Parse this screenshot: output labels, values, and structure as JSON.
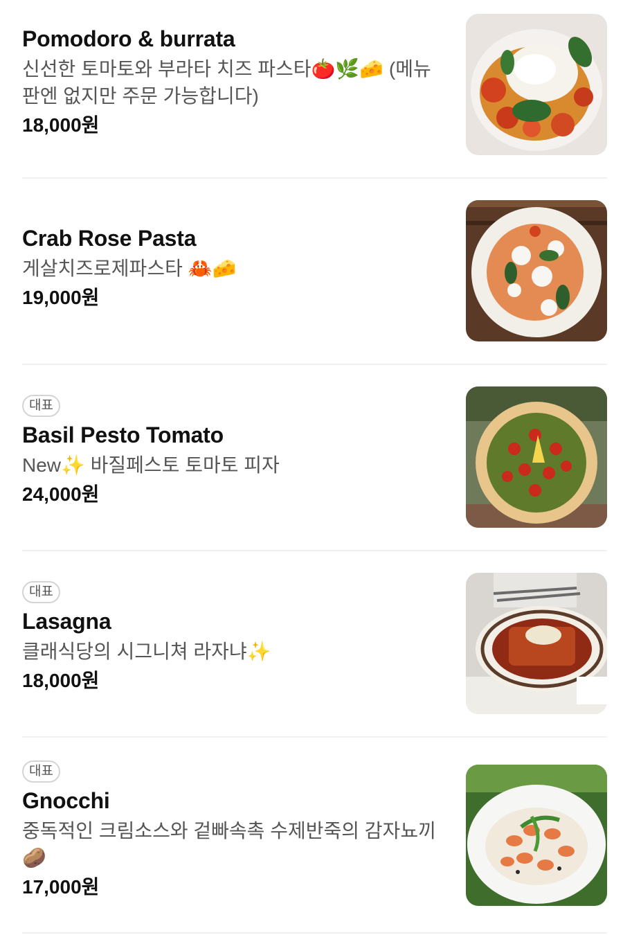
{
  "items": [
    {
      "badge": "",
      "name": "Pomodoro & burrata",
      "desc_line1": "신선한 토마토와 부라타 치즈 파스타🍅🌿🧀 (메뉴",
      "desc_line2": "판엔 없지만 주문 가능합니다)",
      "price": "18,000원",
      "photo": "tomato-burrata-pasta"
    },
    {
      "badge": "",
      "name": "Crab Rose Pasta",
      "desc_line1": "게살치즈로제파스타 🦀🧀",
      "desc_line2": "",
      "price": "19,000원",
      "photo": "crab-rose-pasta"
    },
    {
      "badge": "대표",
      "name": "Basil Pesto Tomato",
      "desc_line1": "New✨ 바질페스토 토마토 피자",
      "desc_line2": "",
      "price": "24,000원",
      "photo": "pesto-tomato-pizza"
    },
    {
      "badge": "대표",
      "name": "Lasagna",
      "desc_line1": "클래식당의 시그니쳐 라자냐✨",
      "desc_line2": "",
      "price": "18,000원",
      "photo": "lasagna"
    },
    {
      "badge": "대표",
      "name": "Gnocchi",
      "desc_line1": "중독적인 크림소스와 겉빠속촉 수제반죽의 감자뇨끼",
      "desc_line2": "🥔",
      "price": "17,000원",
      "photo": "gnocchi"
    }
  ]
}
